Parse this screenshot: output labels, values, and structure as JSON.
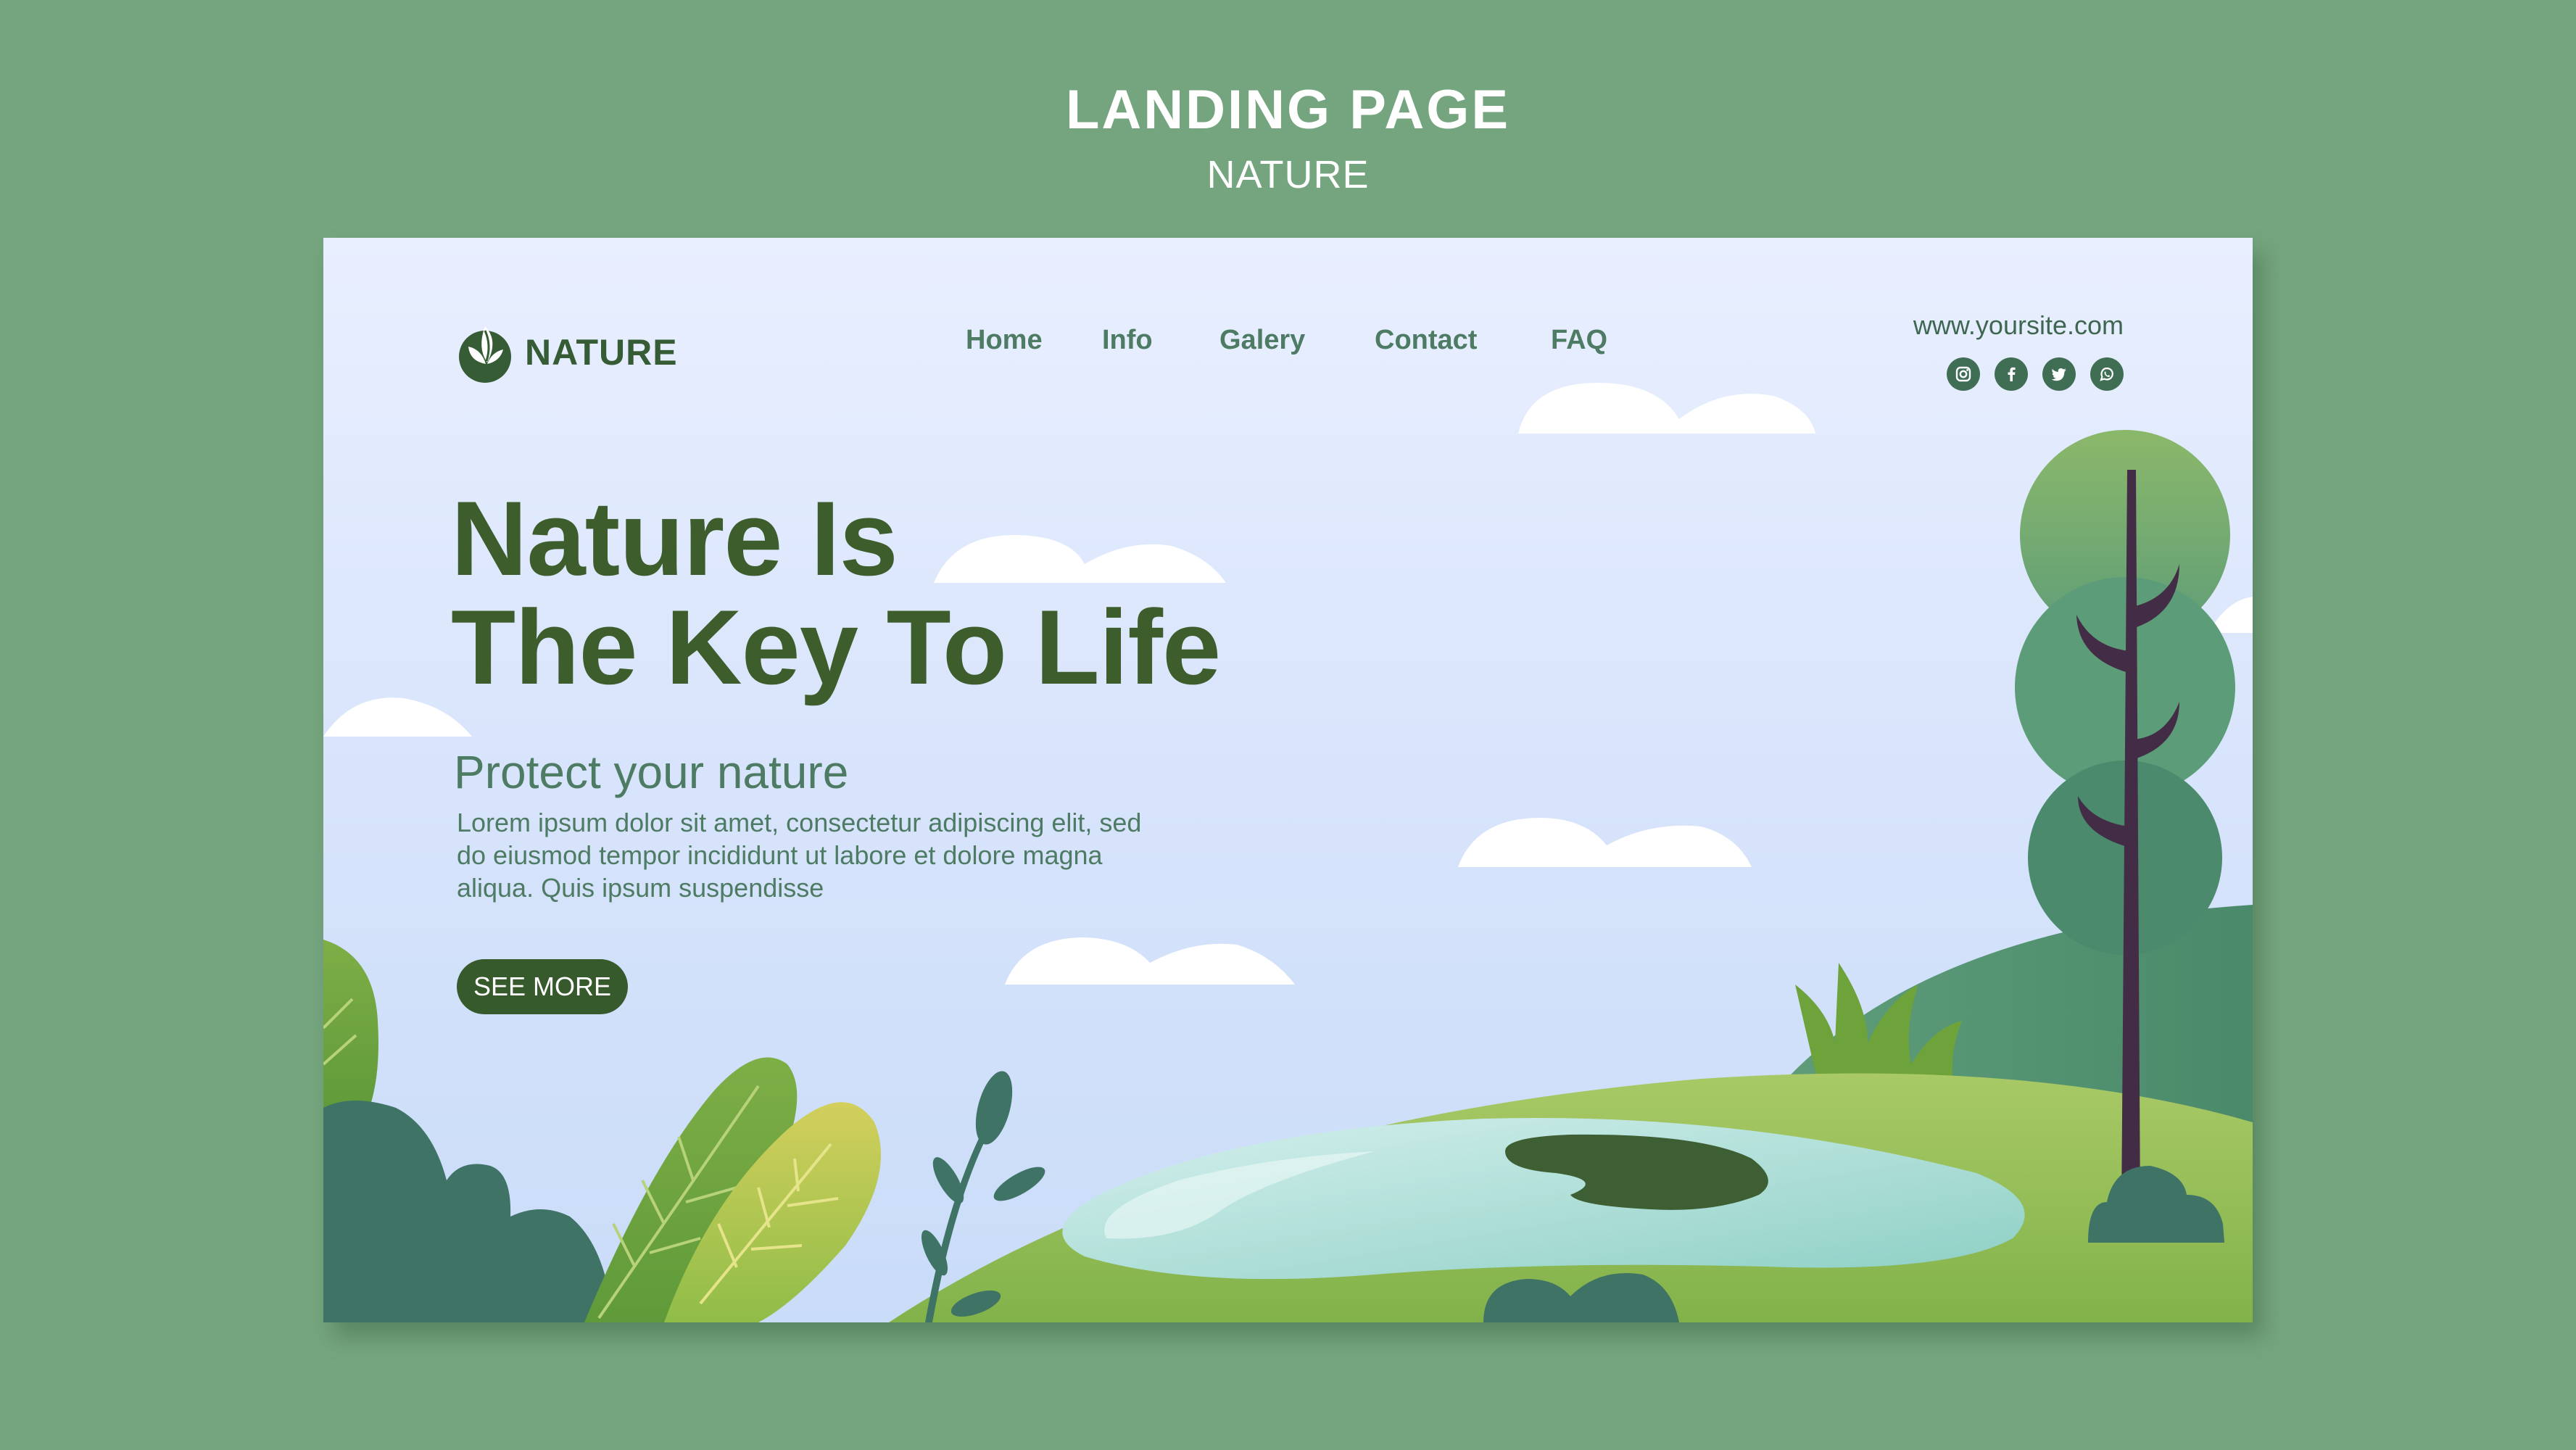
{
  "page_header": {
    "title": "LANDING PAGE",
    "subtitle": "NATURE"
  },
  "site": {
    "logo_text": "NATURE",
    "url": "www.yoursite.com"
  },
  "nav": {
    "items": [
      {
        "label": "Home"
      },
      {
        "label": "Info"
      },
      {
        "label": "Galery"
      },
      {
        "label": "Contact"
      },
      {
        "label": "FAQ"
      }
    ]
  },
  "socials": [
    {
      "icon": "instagram-icon"
    },
    {
      "icon": "facebook-icon"
    },
    {
      "icon": "twitter-icon"
    },
    {
      "icon": "whatsapp-icon"
    }
  ],
  "hero": {
    "headline_line1": "Nature Is",
    "headline_line2": "The Key To Life",
    "tagline": "Protect your nature",
    "body": "Lorem ipsum dolor sit amet, consectetur adipiscing elit, sed do eiusmod tempor incididunt ut labore et dolore magna aliqua. Quis ipsum suspendisse",
    "cta_label": "SEE MORE"
  },
  "colors": {
    "background": "#75a57e",
    "heading": "#3d5e2c",
    "nav_text": "#4d7b63",
    "button": "#365a2c",
    "sky_top": "#e9efff",
    "sky_bottom": "#c9dcf8",
    "grass": "#8fbd55",
    "pond": "#a9dcd6"
  }
}
